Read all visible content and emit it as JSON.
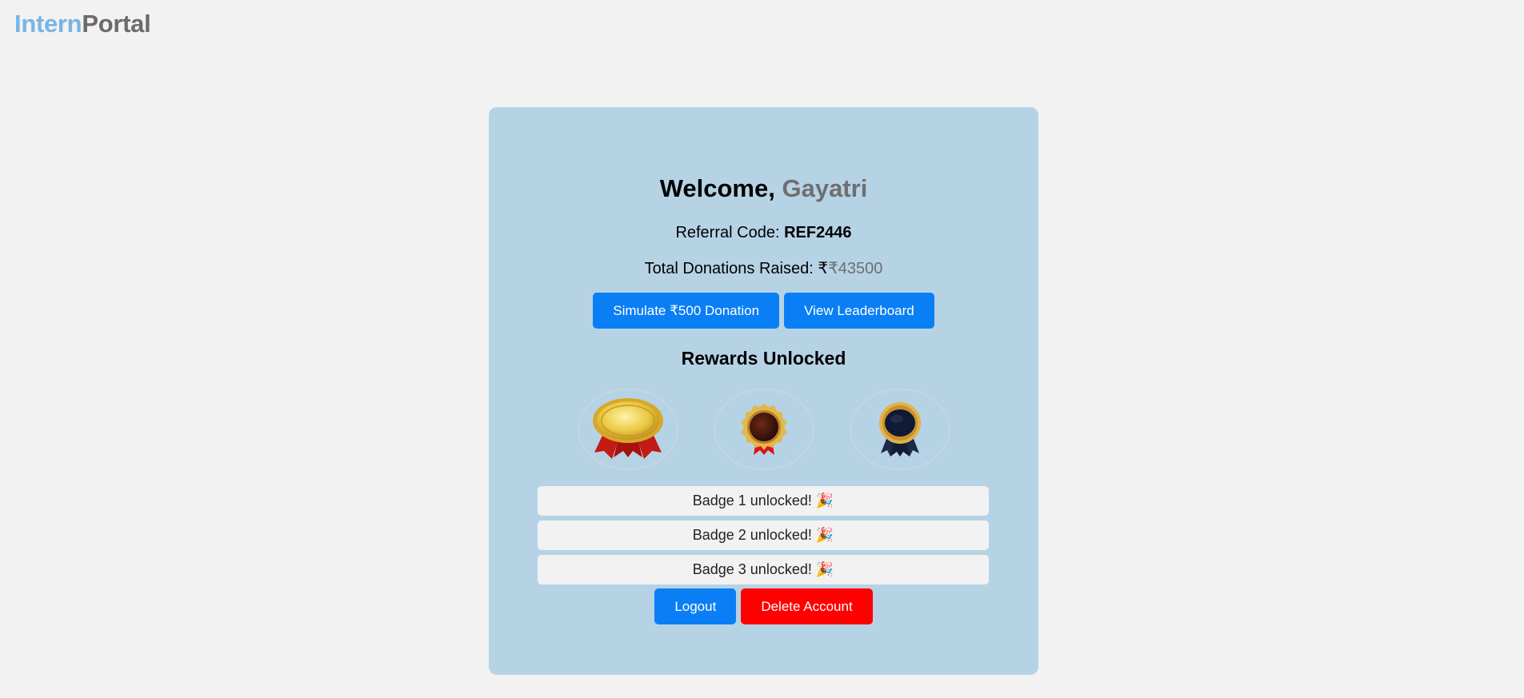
{
  "brand": {
    "part1": "Intern",
    "part2": "Portal"
  },
  "welcome": {
    "prefix": "Welcome,",
    "name": "Gayatri"
  },
  "referral": {
    "label": "Referral Code:",
    "code": "REF2446"
  },
  "donations": {
    "label": "Total Donations Raised: ₹",
    "amount": "₹43500"
  },
  "actions": {
    "simulate_label": "Simulate ₹500 Donation",
    "leaderboard_label": "View Leaderboard",
    "logout_label": "Logout",
    "delete_label": "Delete Account"
  },
  "rewards": {
    "title": "Rewards Unlocked",
    "badges": [
      {
        "icon": "gold-medal-icon"
      },
      {
        "icon": "bronze-medal-icon"
      },
      {
        "icon": "navy-rosette-icon"
      }
    ],
    "messages": [
      "Badge 1 unlocked! 🎉",
      "Badge 2 unlocked! 🎉",
      "Badge 3 unlocked! 🎉"
    ]
  },
  "colors": {
    "brand_primary": "#76b5e6",
    "brand_secondary": "#6b6b6b",
    "card_bg": "#b6d3e5",
    "button_blue": "#0a7ff5",
    "button_red": "#ff0000"
  }
}
